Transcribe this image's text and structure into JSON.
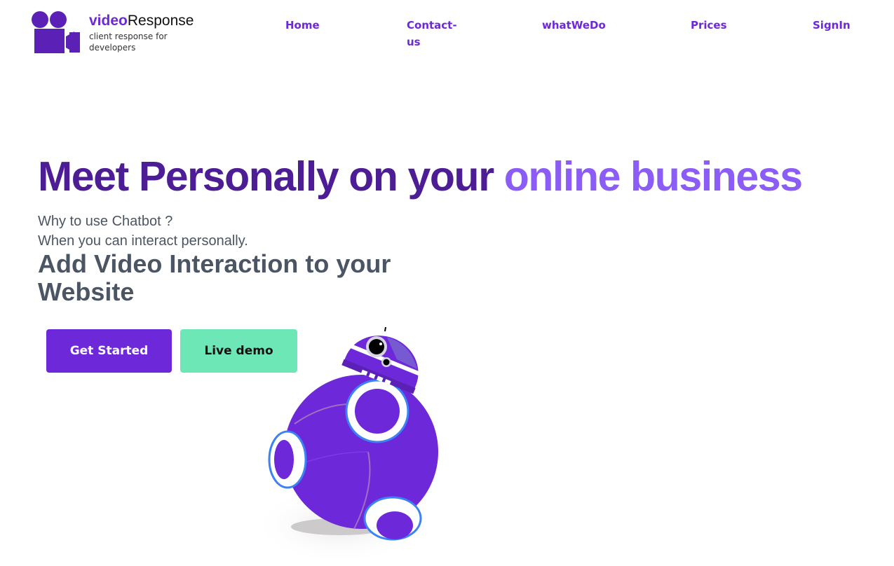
{
  "header": {
    "brand_video": "video",
    "brand_response": "Response",
    "tagline": "client response for developers",
    "logo_icon": "video-camera-icon"
  },
  "nav": {
    "home": "Home",
    "contact": "Contact-us",
    "what": "whatWeDo",
    "prices": "Prices",
    "signin": "SignIn"
  },
  "hero": {
    "title_main": "Meet Personally on your ",
    "title_accent": "online business",
    "sub1": "Why to use Chatbot ?",
    "sub2": "When you can interact personally.",
    "headline": "Add Video Interaction to your Website",
    "illustration": "bb8-robot-illustration"
  },
  "buttons": {
    "get_started": "Get Started",
    "live_demo": "Live demo"
  },
  "colors": {
    "brand_purple": "#6d28d9",
    "title_dark_purple": "#4c1d95",
    "title_accent_purple": "#8b5cf6",
    "body_gray": "#4b5563",
    "demo_green": "#6ee7b7"
  }
}
